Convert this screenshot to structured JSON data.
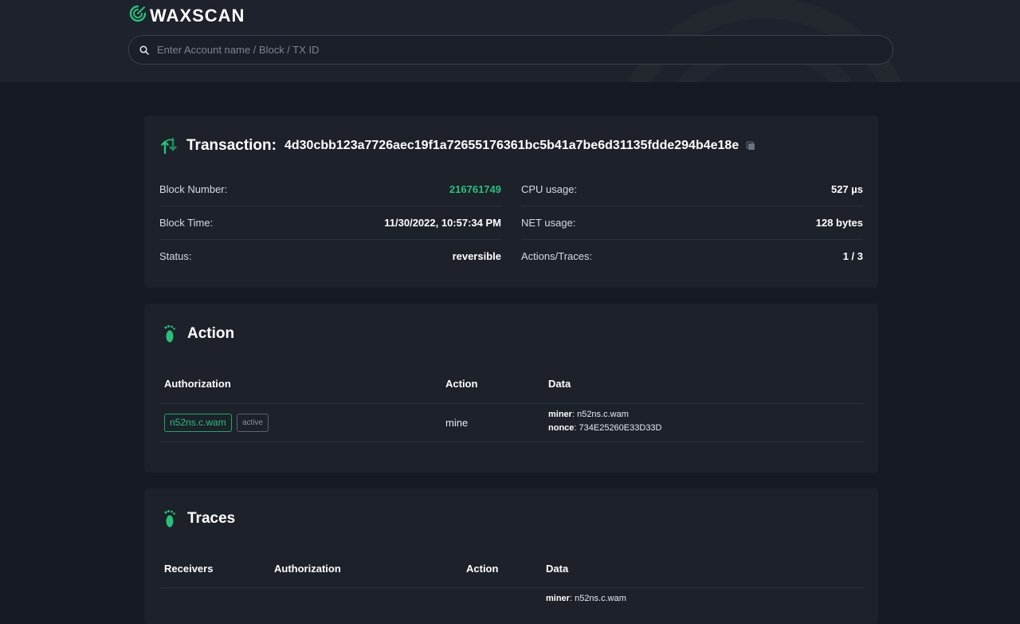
{
  "brand": {
    "name": "WAXSCAN",
    "accent": "#27c178"
  },
  "search": {
    "placeholder": "Enter Account name / Block / TX ID"
  },
  "transaction": {
    "title": "Transaction:",
    "hash": "4d30cbb123a7726aec19f1a72655176361bc5b41a7be6d31135fdde294b4e18e",
    "rows": {
      "block_number": {
        "label": "Block Number:",
        "value": "216761749"
      },
      "block_time": {
        "label": "Block Time:",
        "value": "11/30/2022, 10:57:34 PM"
      },
      "status": {
        "label": "Status:",
        "value": "reversible"
      },
      "cpu": {
        "label": "CPU usage:",
        "value": "527 µs"
      },
      "net": {
        "label": "NET usage:",
        "value": "128 bytes"
      },
      "actions": {
        "label": "Actions/Traces:",
        "value": "1 / 3"
      }
    }
  },
  "action": {
    "title": "Action",
    "headers": {
      "authorization": "Authorization",
      "action": "Action",
      "data": "Data"
    },
    "row": {
      "actor": "n52ns.c.wam",
      "permission": "active",
      "action": "mine",
      "data": [
        {
          "key": "miner",
          "value": ": n52ns.c.wam"
        },
        {
          "key": "nonce",
          "value": ": 734E25260E33D33D"
        }
      ]
    }
  },
  "traces": {
    "title": "Traces",
    "headers": {
      "receivers": "Receivers",
      "authorization": "Authorization",
      "action": "Action",
      "data": "Data"
    },
    "row": {
      "data": [
        {
          "key": "miner",
          "value": ": n52ns.c.wam"
        }
      ]
    }
  },
  "icons": {
    "logo": "waxscan-logo-icon",
    "search": "search-icon",
    "transaction": "transfer-arrows-icon",
    "copy": "copy-icon",
    "action": "footprint-icon",
    "traces": "footprint-icon"
  }
}
